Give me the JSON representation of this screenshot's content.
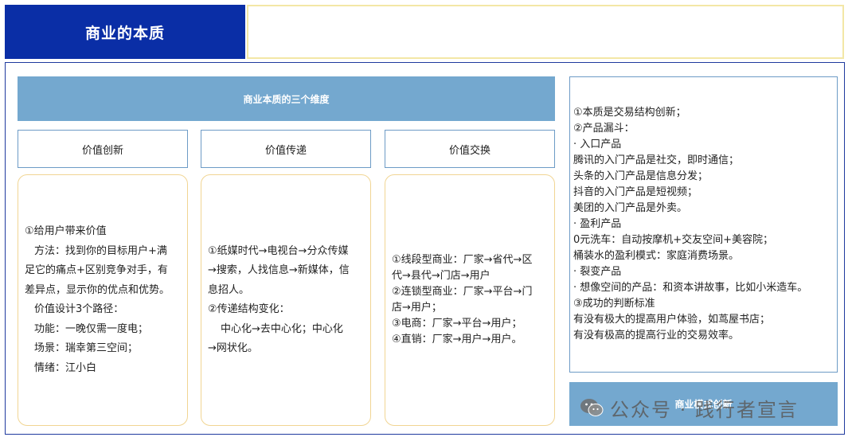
{
  "title": "商业的本质",
  "banner": "商业本质的三个维度",
  "columns": [
    {
      "header": "价值创新",
      "lines": [
        "①给用户带来价值",
        "方法：找到你的目标用户+满",
        "足它的痛点+区别竞争对手，有",
        "差异点，显示你的优点和优势。",
        "价值设计3个路径：",
        "功能：一晚仅需一度电；",
        "场景：瑞幸第三空间；",
        "情绪：江小白"
      ]
    },
    {
      "header": "价值传递",
      "lines": [
        "①纸媒时代→电视台→分众传媒",
        "→搜索，人找信息→新媒体，信",
        "息招人。",
        "②传递结构变化：",
        "中心化→去中心化；中心化",
        "→网状化。"
      ]
    },
    {
      "header": "价值交换",
      "lines": [
        "①线段型商业：厂家→省代→区",
        "代→县代→门店→用户",
        "②连锁型商业：厂家→平台→门",
        "店→用户；",
        "③电商：厂家→平台→用户；",
        "④直销：厂家→用户→用户。"
      ]
    }
  ],
  "right_panel": [
    "①本质是交易结构创新；",
    "②产品漏斗：",
    "· 入口产品",
    "腾讯的入门产品是社交，即时通信；",
    "头条的入门产品是信息分发；",
    "抖音的入门产品是短视频；",
    "美团的入门产品是外卖。",
    "· 盈利产品",
    "0元洗车：自动按摩机+交友空间+美容院；",
    "桶装水的盈利模式：家庭消费场景。",
    "· 裂变产品",
    "· 想像空间的产品：和资本讲故事，比如小米造车。",
    "③成功的判断标准",
    "有没有极大的提高用户体验，如茑屋书店；",
    "有没有极高的提高行业的交易效率。"
  ],
  "bottom_box": "商业模式创新",
  "watermark": "公众号 · 践行者宣言",
  "colors": {
    "title_bg": "#0a2ea6",
    "banner_bg": "#74a8cf",
    "header_border": "#6d9bc6",
    "body_border": "#f1d593",
    "frame_border": "#1f3a9e"
  },
  "icons": [
    "wechat-icon"
  ]
}
